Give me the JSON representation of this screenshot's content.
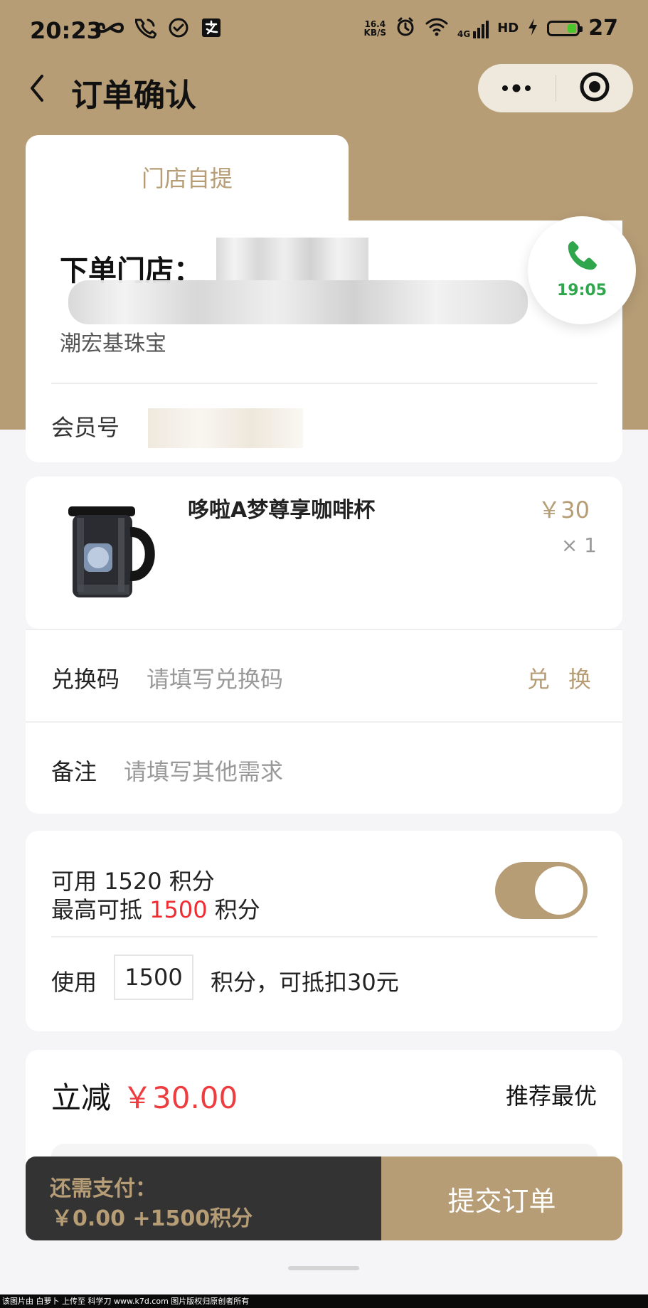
{
  "status_bar": {
    "time": "20:23",
    "network_speed_top": "16.4",
    "network_speed_bottom": "KB/S",
    "network_type": "4G",
    "battery_level": "27"
  },
  "nav": {
    "title": "订单确认"
  },
  "pickup": {
    "tab_label": "门店自提",
    "store_title": "下单门店：",
    "store_name": "潮宏基珠宝",
    "member_label": "会员号",
    "phone_time": "19:05"
  },
  "product": {
    "name": "哆啦A梦尊享咖啡杯",
    "price": "￥30",
    "quantity": "× 1"
  },
  "redeem": {
    "label": "兑换码",
    "placeholder": "请填写兑换码",
    "action": "兑 换"
  },
  "remark": {
    "label": "备注",
    "placeholder": "请填写其他需求"
  },
  "points": {
    "available_prefix": "可用",
    "available_value": "1520",
    "available_suffix": "积分",
    "max_prefix": "最高可抵",
    "max_value": "1500",
    "max_suffix": "积分",
    "use_label": "使用",
    "use_value": "1500",
    "use_suffix": "积分，可抵扣30元",
    "enabled": true
  },
  "discount": {
    "label": "立减",
    "value": "￥30.00",
    "recommend": "推荐最优"
  },
  "bottom_bar": {
    "pay_label": "还需支付：",
    "pay_amount": "￥0.00 +1500积分",
    "submit_label": "提交订单"
  },
  "footer": {
    "text": "该图片由 白萝卜 上传至 科学刀 www.k7d.com 图片版权归原创者所有"
  },
  "colors": {
    "brand": "#b69d76",
    "red": "#ef2c31",
    "success": "#2fa64b"
  }
}
